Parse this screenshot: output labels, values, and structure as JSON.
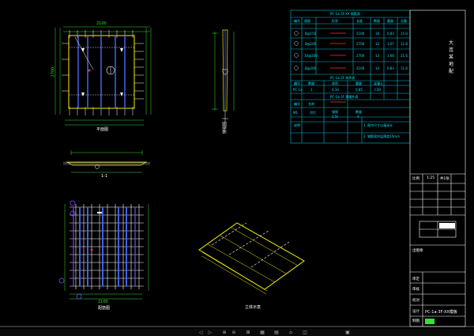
{
  "views": {
    "plan_top": {
      "title": "平面图",
      "dim_bottom": "2100",
      "dim_left": "2700"
    },
    "section_side": {
      "title": "侧视图"
    },
    "section_mid": {
      "title": "1-1"
    },
    "rebar_plan": {
      "title": "配筋图",
      "dim_bottom": "2100"
    },
    "isometric": {
      "title": "立体示意"
    }
  },
  "cyan_table": {
    "title_1": "PC-1a-3F-XX 钢筋表",
    "headers_1": [
      "编号",
      "规格",
      "形状",
      "长度",
      "数量",
      "重量",
      "总重"
    ],
    "rows_1": [
      [
        "①",
        "8@150",
        "2100",
        "2100",
        "18",
        "0.83",
        "15.0"
      ],
      [
        "②",
        "8@200",
        "2700",
        "2700",
        "12",
        "1.07",
        "12.8"
      ],
      [
        "③",
        "10@200",
        "2700",
        "2700",
        "13",
        "1.66",
        "21.6"
      ],
      [
        "④",
        "8@200",
        "2100",
        "2100",
        "14",
        "0.83",
        "11.6"
      ]
    ],
    "title_2": "PC-1a-3F 构件表",
    "headers_2": [
      "编号",
      "数量",
      "体积",
      "重量",
      "混凝土"
    ],
    "rows_2": [
      [
        "PC-1a",
        "1",
        "0.34",
        "0.85",
        "C30"
      ]
    ],
    "title_3": "PC-1a-3F 预埋件表",
    "headers_3": [
      "编号",
      "名称",
      "规格",
      "数量"
    ],
    "rows_3": [
      [
        "M1",
        "吊钉",
        "2.5t",
        "4"
      ]
    ],
    "title_4": "说明",
    "notes": [
      "1. 图中尺寸以毫米计",
      "2. 钢筋保护层厚度15mm"
    ]
  },
  "title_block": {
    "project": "大 连 某 地 配",
    "row_labels": [
      "审定",
      "审核",
      "校对",
      "设计",
      "制图",
      "比例"
    ],
    "drawing_name": "PC-1a-3F-XX模板",
    "scale": "1:25",
    "sheet": "共1张",
    "stamp": "出图章"
  },
  "toolbar": {
    "buttons": [
      "◁",
      "▷",
      "⊕",
      "⊖",
      "⊞",
      "▦",
      "▤",
      "⌂",
      "◫",
      "▣"
    ]
  }
}
